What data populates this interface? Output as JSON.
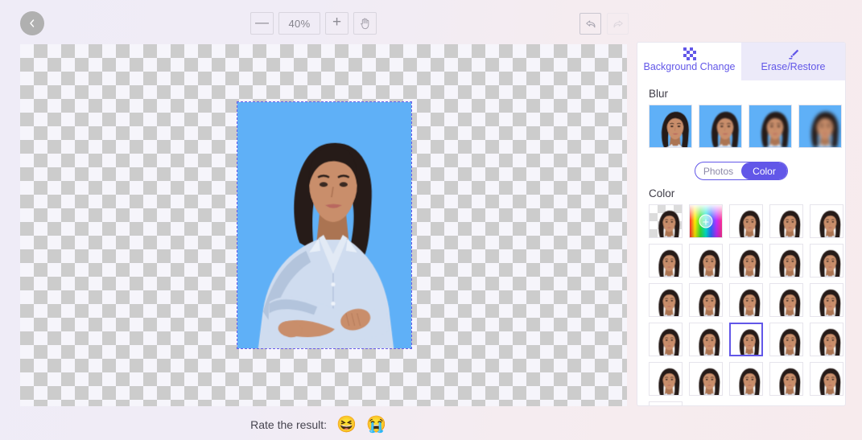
{
  "toolbar": {
    "back_icon": "chevron-left-icon",
    "zoom_out_label": "—",
    "zoom_level": "40%",
    "zoom_in_label": "+",
    "hand_icon": "hand-tool-icon",
    "undo_icon": "undo-arrow-icon",
    "redo_icon": "redo-arrow-icon"
  },
  "canvas": {
    "background_type": "transparent-checkerboard",
    "selection_border_color": "#6b5ce7",
    "image_background_color": "#5fb0f7"
  },
  "panel": {
    "tabs": [
      {
        "label": "Background Change",
        "icon": "checkerboard-icon",
        "active": true
      },
      {
        "label": "Erase/Restore",
        "icon": "brush-pencil-icon",
        "active": false
      }
    ],
    "blur": {
      "title": "Blur",
      "thumbs": [
        {
          "name": "blur-level-1",
          "blur": 0,
          "bg": "#5fb0f7"
        },
        {
          "name": "blur-level-2",
          "blur": 1,
          "bg": "#5fb0f7"
        },
        {
          "name": "blur-level-3",
          "blur": 2,
          "bg": "#5fb0f7"
        },
        {
          "name": "blur-level-4",
          "blur": 3,
          "bg": "#5fb0f7"
        }
      ]
    },
    "source_toggle": {
      "options": [
        "Photos",
        "Color"
      ],
      "selected": "Color"
    },
    "color": {
      "title": "Color",
      "selected_index": 17,
      "swatches": [
        {
          "name": "transparent",
          "hex": "transparent"
        },
        {
          "name": "color-picker",
          "hex": "picker"
        },
        {
          "name": "black",
          "hex": "#0a0a0a"
        },
        {
          "name": "dark-gray",
          "hex": "#5b5b5b"
        },
        {
          "name": "gray",
          "hex": "#777777"
        },
        {
          "name": "mid-gray",
          "hex": "#9b9b9b"
        },
        {
          "name": "light-gray",
          "hex": "#dcdcdc"
        },
        {
          "name": "white",
          "hex": "#ffffff"
        },
        {
          "name": "red",
          "hex": "#ee3425"
        },
        {
          "name": "salmon-red",
          "hex": "#f2594e"
        },
        {
          "name": "pink",
          "hex": "#f44f9e"
        },
        {
          "name": "orchid",
          "hex": "#b95de0"
        },
        {
          "name": "purple",
          "hex": "#8c4df2"
        },
        {
          "name": "violet",
          "hex": "#5a17e0"
        },
        {
          "name": "teal",
          "hex": "#3aa99a"
        },
        {
          "name": "light-teal",
          "hex": "#62c9c4"
        },
        {
          "name": "aquamarine",
          "hex": "#7de3d2"
        },
        {
          "name": "light-blue",
          "hex": "#5fb0f7"
        },
        {
          "name": "blue",
          "hex": "#4a6ef0"
        },
        {
          "name": "dark-blue",
          "hex": "#1f3f9e"
        },
        {
          "name": "dark-green",
          "hex": "#2c7a33"
        },
        {
          "name": "light-green",
          "hex": "#8dd95e"
        },
        {
          "name": "yellow-green",
          "hex": "#c6dd63"
        },
        {
          "name": "yellow",
          "hex": "#f4da55"
        },
        {
          "name": "light-orange",
          "hex": "#f5bf63"
        },
        {
          "name": "orange",
          "hex": "#f2994a"
        }
      ]
    }
  },
  "rate": {
    "label": "Rate the result:",
    "happy_emoji": "😆",
    "sad_emoji": "😭"
  }
}
